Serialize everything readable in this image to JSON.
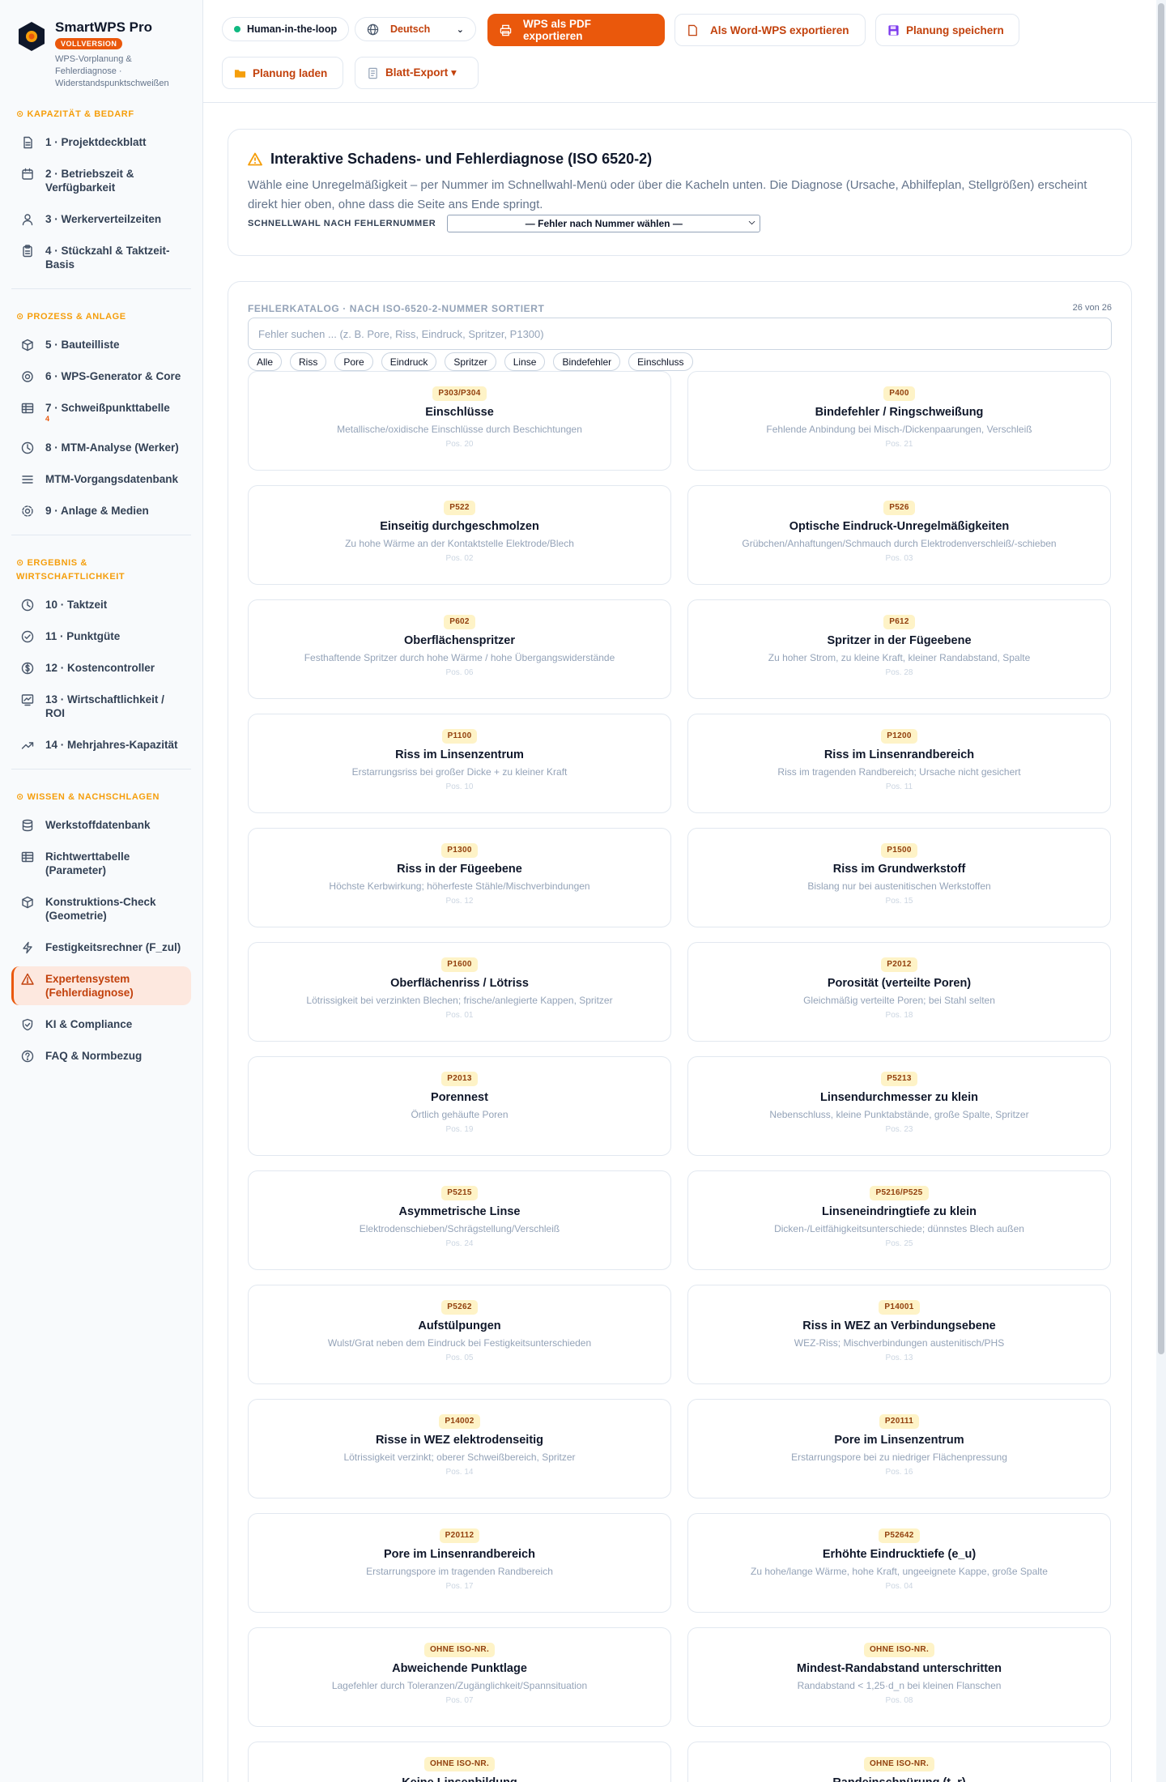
{
  "brand": {
    "title": "SmartWPS Pro",
    "badge": "VOLLVERSION",
    "subtitle": "WPS-Vorplanung & Fehlerdiagnose · Widerstandspunktschweißen"
  },
  "sidebar": {
    "sections": [
      {
        "title": "⊙ KAPAZITÄT & BEDARF",
        "items": [
          {
            "label": "1 · Projektdeckblatt",
            "icon": "file-icon"
          },
          {
            "label": "2 · Betriebszeit & Verfügbarkeit",
            "icon": "calendar-icon"
          },
          {
            "label": "3 · Werkerverteilzeiten",
            "icon": "user-icon"
          },
          {
            "label": "4 · Stückzahl & Taktzeit-Basis",
            "icon": "clipboard-icon"
          }
        ]
      },
      {
        "title": "⊙ PROZESS & ANLAGE",
        "items": [
          {
            "label": "5 · Bauteilliste",
            "icon": "box-icon"
          },
          {
            "label": "6 · WPS-Generator & Core",
            "icon": "target-icon"
          },
          {
            "label": "7 · Schweißpunkttabelle",
            "icon": "table-icon",
            "sup": "4"
          },
          {
            "label": "8 · MTM-Analyse (Werker)",
            "icon": "clock-icon"
          },
          {
            "label": "MTM-Vorgangsdatenbank",
            "icon": "list-icon"
          },
          {
            "label": "9 · Anlage & Medien",
            "icon": "gear-icon"
          }
        ]
      },
      {
        "title": "⊙ ERGEBNIS & WIRTSCHAFTLICHKEIT",
        "items": [
          {
            "label": "10 · Taktzeit",
            "icon": "clock-icon"
          },
          {
            "label": "11 · Punktgüte",
            "icon": "check-circle-icon"
          },
          {
            "label": "12 · Kostencontroller",
            "icon": "dollar-icon"
          },
          {
            "label": "13 · Wirtschaftlichkeit / ROI",
            "icon": "chart-icon"
          },
          {
            "label": "14 · Mehrjahres-Kapazität",
            "icon": "trend-icon"
          }
        ]
      },
      {
        "title": "⊙ WISSEN & NACHSCHLAGEN",
        "items": [
          {
            "label": "Werkstoffdatenbank",
            "icon": "database-icon"
          },
          {
            "label": "Richtwerttabelle (Parameter)",
            "icon": "table-icon"
          },
          {
            "label": "Konstruktions-Check (Geometrie)",
            "icon": "box-icon"
          },
          {
            "label": "Festigkeitsrechner (F_zul)",
            "icon": "bolt-icon"
          },
          {
            "label": "Expertensystem (Fehlerdiagnose)",
            "icon": "warning-icon",
            "active": true
          },
          {
            "label": "KI & Compliance",
            "icon": "shield-icon"
          },
          {
            "label": "FAQ & Normbezug",
            "icon": "help-icon"
          }
        ]
      }
    ]
  },
  "topbar": {
    "hitl": "Human-in-the-loop",
    "language": "Deutsch",
    "pdf_export": "WPS als PDF exportieren",
    "word_export": "Als Word-WPS exportieren",
    "save": "Planung speichern",
    "load": "Planung laden",
    "sheet_export": "Blatt-Export ▾"
  },
  "diagnosis": {
    "title": "Interaktive Schadens- und Fehlerdiagnose (ISO 6520-2)",
    "description": "Wähle eine Unregelmäßigkeit – per Nummer im Schnellwahl-Menü oder über die Kacheln unten. Die Diagnose (Ursache, Abhilfeplan, Stellgrößen) erscheint direkt hier oben, ohne dass die Seite ans Ende springt.",
    "quickselect_label": "SCHNELLWAHL NACH FEHLERNUMMER",
    "quickselect_value": "— Fehler nach Nummer wählen —"
  },
  "catalog": {
    "title": "FEHLERKATALOG · NACH ISO-6520-2-NUMMER SORTIERT",
    "count": "26 von 26",
    "search_placeholder": "Fehler suchen ... (z. B. Pore, Riss, Eindruck, Spritzer, P1300)",
    "filters": [
      "Alle",
      "Riss",
      "Pore",
      "Eindruck",
      "Spritzer",
      "Linse",
      "Bindefehler",
      "Einschluss"
    ],
    "tiles": [
      {
        "code": "P303/P304",
        "title": "Einschlüsse",
        "desc": "Metallische/oxidische Einschlüsse durch Beschichtungen",
        "pos": "Pos. 20"
      },
      {
        "code": "P400",
        "title": "Bindefehler / Ringschweißung",
        "desc": "Fehlende Anbindung bei Misch-/Dickenpaarungen, Verschleiß",
        "pos": "Pos. 21"
      },
      {
        "code": "P522",
        "title": "Einseitig durchgeschmolzen",
        "desc": "Zu hohe Wärme an der Kontaktstelle Elektrode/Blech",
        "pos": "Pos. 02"
      },
      {
        "code": "P526",
        "title": "Optische Eindruck-Unregelmäßigkeiten",
        "desc": "Grübchen/Anhaftungen/Schmauch durch Elektrodenverschleiß/-schieben",
        "pos": "Pos. 03"
      },
      {
        "code": "P602",
        "title": "Oberflächenspritzer",
        "desc": "Festhaftende Spritzer durch hohe Wärme / hohe Übergangswiderstände",
        "pos": "Pos. 06"
      },
      {
        "code": "P612",
        "title": "Spritzer in der Fügeebene",
        "desc": "Zu hoher Strom, zu kleine Kraft, kleiner Randabstand, Spalte",
        "pos": "Pos. 28"
      },
      {
        "code": "P1100",
        "title": "Riss im Linsenzentrum",
        "desc": "Erstarrungsriss bei großer Dicke + zu kleiner Kraft",
        "pos": "Pos. 10"
      },
      {
        "code": "P1200",
        "title": "Riss im Linsenrandbereich",
        "desc": "Riss im tragenden Randbereich; Ursache nicht gesichert",
        "pos": "Pos. 11"
      },
      {
        "code": "P1300",
        "title": "Riss in der Fügeebene",
        "desc": "Höchste Kerbwirkung; höherfeste Stähle/Mischverbindungen",
        "pos": "Pos. 12"
      },
      {
        "code": "P1500",
        "title": "Riss im Grundwerkstoff",
        "desc": "Bislang nur bei austenitischen Werkstoffen",
        "pos": "Pos. 15"
      },
      {
        "code": "P1600",
        "title": "Oberflächenriss / Lötriss",
        "desc": "Lötrissigkeit bei verzinkten Blechen; frische/anlegierte Kappen, Spritzer",
        "pos": "Pos. 01"
      },
      {
        "code": "P2012",
        "title": "Porosität (verteilte Poren)",
        "desc": "Gleichmäßig verteilte Poren; bei Stahl selten",
        "pos": "Pos. 18"
      },
      {
        "code": "P2013",
        "title": "Porennest",
        "desc": "Örtlich gehäufte Poren",
        "pos": "Pos. 19"
      },
      {
        "code": "P5213",
        "title": "Linsendurchmesser zu klein",
        "desc": "Nebenschluss, kleine Punktabstände, große Spalte, Spritzer",
        "pos": "Pos. 23"
      },
      {
        "code": "P5215",
        "title": "Asymmetrische Linse",
        "desc": "Elektrodenschieben/Schrägstellung/Verschleiß",
        "pos": "Pos. 24"
      },
      {
        "code": "P5216/P525",
        "title": "Linseneindringtiefe zu klein",
        "desc": "Dicken-/Leitfähigkeitsunterschiede; dünnstes Blech außen",
        "pos": "Pos. 25"
      },
      {
        "code": "P5262",
        "title": "Aufstülpungen",
        "desc": "Wulst/Grat neben dem Eindruck bei Festigkeitsunterschieden",
        "pos": "Pos. 05"
      },
      {
        "code": "P14001",
        "title": "Riss in WEZ an Verbindungsebene",
        "desc": "WEZ-Riss; Mischverbindungen austenitisch/PHS",
        "pos": "Pos. 13"
      },
      {
        "code": "P14002",
        "title": "Risse in WEZ elektrodenseitig",
        "desc": "Lötrissigkeit verzinkt; oberer Schweißbereich, Spritzer",
        "pos": "Pos. 14"
      },
      {
        "code": "P20111",
        "title": "Pore im Linsenzentrum",
        "desc": "Erstarrungspore bei zu niedriger Flächenpressung",
        "pos": "Pos. 16"
      },
      {
        "code": "P20112",
        "title": "Pore im Linsenrandbereich",
        "desc": "Erstarrungspore im tragenden Randbereich",
        "pos": "Pos. 17"
      },
      {
        "code": "P52642",
        "title": "Erhöhte Eindrucktiefe (e_u)",
        "desc": "Zu hohe/lange Wärme, hohe Kraft, ungeeignete Kappe, große Spalte",
        "pos": "Pos. 04"
      },
      {
        "code": "OHNE ISO-NR.",
        "title": "Abweichende Punktlage",
        "desc": "Lagefehler durch Toleranzen/Zugänglichkeit/Spannsituation",
        "pos": "Pos. 07"
      },
      {
        "code": "OHNE ISO-NR.",
        "title": "Mindest-Randabstand unterschritten",
        "desc": "Randabstand < 1,25·d_n bei kleinen Flanschen",
        "pos": "Pos. 08"
      },
      {
        "code": "OHNE ISO-NR.",
        "title": "Keine Linsenbildung",
        "desc": "",
        "pos": ""
      },
      {
        "code": "OHNE ISO-NR.",
        "title": "Randeinschnürung (t_r)",
        "desc": "",
        "pos": ""
      }
    ]
  },
  "colors": {
    "accent": "#ea580c",
    "section": "#f59e0b",
    "active_bg": "#fde8df",
    "code_bg": "#fef3c7"
  }
}
